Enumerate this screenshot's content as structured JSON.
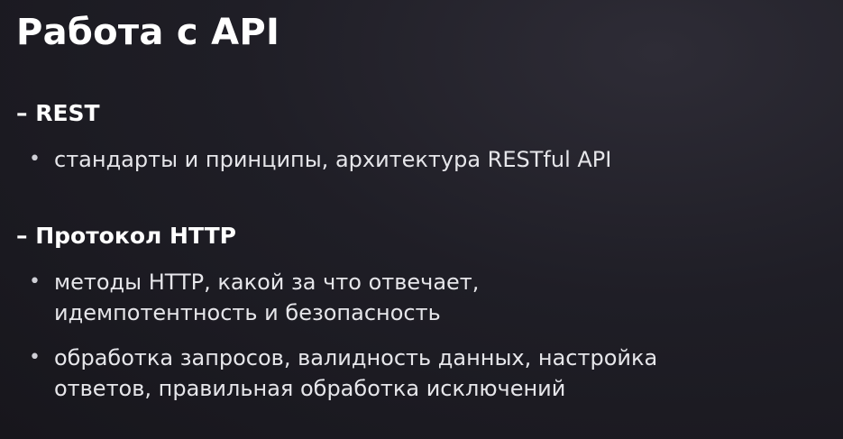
{
  "slide": {
    "title": "Работа с API",
    "sections": [
      {
        "heading": "– REST",
        "bullets": [
          {
            "marker": "•",
            "lines": [
              "стандарты и принципы, архитектура RESTful API"
            ]
          }
        ]
      },
      {
        "heading": "– Протокол HTTP",
        "bullets": [
          {
            "marker": "•",
            "lines": [
              "методы HTTP, какой за что отвечает,",
              "идемпотентность и безопасность"
            ]
          },
          {
            "marker": "•",
            "lines": [
              "обработка запросов, валидность данных, настройка",
              "ответов, правильная обработка исключений"
            ]
          }
        ]
      }
    ]
  }
}
